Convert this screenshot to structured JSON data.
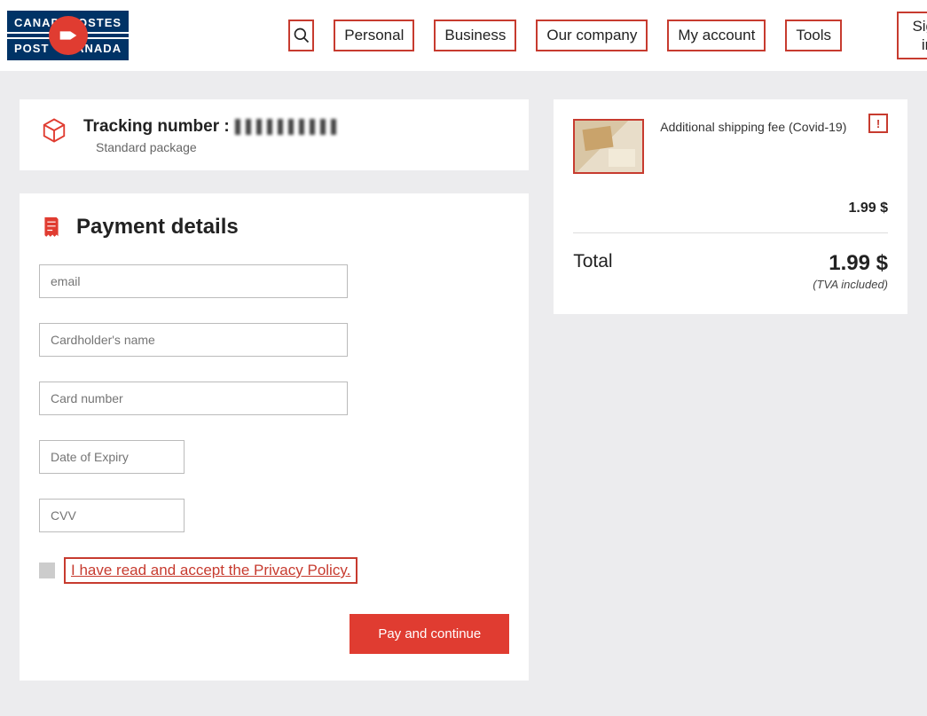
{
  "logo": {
    "tl": "CANADA",
    "tr": "POSTES",
    "bl": "POST",
    "br": "CANADA"
  },
  "nav": {
    "personal": "Personal",
    "business": "Business",
    "company": "Our company",
    "account": "My account",
    "tools": "Tools",
    "signin": "Sign in"
  },
  "tracking": {
    "label": "Tracking number :",
    "subtitle": "Standard package"
  },
  "payment": {
    "title": "Payment details",
    "placeholders": {
      "email": "email",
      "name": "Cardholder's name",
      "card": "Card number",
      "expiry": "Date of Expiry",
      "cvv": "CVV"
    },
    "privacy": "I have read and accept the Privacy Policy.",
    "pay_btn": "Pay and continue"
  },
  "summary": {
    "desc": "Additional shipping fee (Covid-19)",
    "warn": "!",
    "item_price": "1.99 $",
    "total_label": "Total",
    "total_value": "1.99 $",
    "tva": "(TVA included)"
  }
}
